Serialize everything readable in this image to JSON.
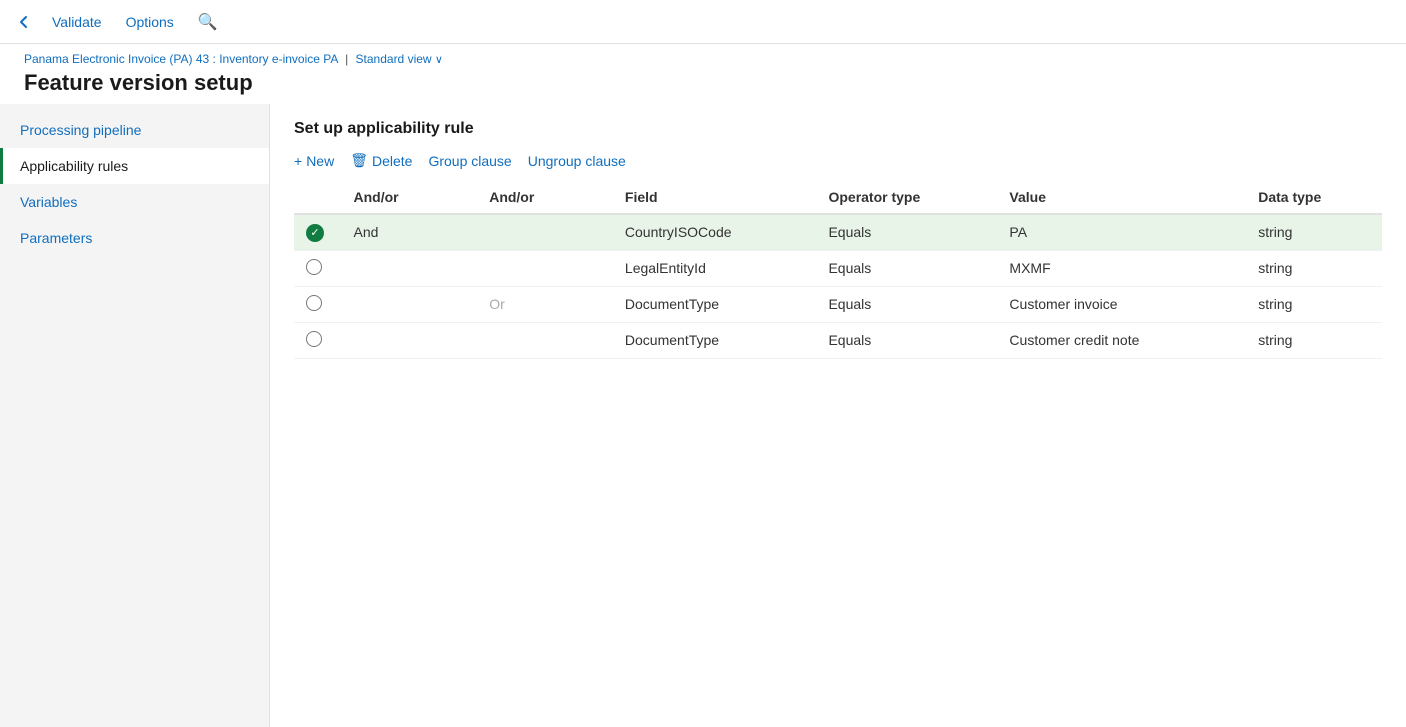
{
  "topNav": {
    "validate": "Validate",
    "options": "Options",
    "searchIcon": "🔍"
  },
  "breadcrumb": {
    "full": "Panama Electronic Invoice (PA) 43 : Inventory e-invoice PA",
    "separator": "|",
    "viewLabel": "Standard view",
    "chevron": "∨"
  },
  "pageTitle": "Feature version setup",
  "sidebar": {
    "items": [
      {
        "id": "processing-pipeline",
        "label": "Processing pipeline",
        "active": false
      },
      {
        "id": "applicability-rules",
        "label": "Applicability rules",
        "active": true
      },
      {
        "id": "variables",
        "label": "Variables",
        "active": false
      },
      {
        "id": "parameters",
        "label": "Parameters",
        "active": false
      }
    ]
  },
  "content": {
    "sectionTitle": "Set up applicability rule",
    "toolbar": {
      "newLabel": "New",
      "deleteLabel": "Delete",
      "groupClauseLabel": "Group clause",
      "ungroupClauseLabel": "Ungroup clause"
    },
    "table": {
      "columns": [
        "And/or",
        "And/or",
        "Field",
        "Operator type",
        "Value",
        "Data type"
      ],
      "rows": [
        {
          "selected": true,
          "hasGreenDot": true,
          "andor1": "And",
          "andor2": "",
          "field": "CountryISOCode",
          "operatorType": "Equals",
          "value": "PA",
          "dataType": "string"
        },
        {
          "selected": false,
          "hasGreenDot": false,
          "andor1": "",
          "andor2": "",
          "field": "LegalEntityId",
          "operatorType": "Equals",
          "value": "MXMF",
          "dataType": "string"
        },
        {
          "selected": false,
          "hasGreenDot": false,
          "andor1": "",
          "andor2": "Or",
          "field": "DocumentType",
          "operatorType": "Equals",
          "value": "Customer invoice",
          "dataType": "string"
        },
        {
          "selected": false,
          "hasGreenDot": false,
          "andor1": "",
          "andor2": "",
          "field": "DocumentType",
          "operatorType": "Equals",
          "value": "Customer credit note",
          "dataType": "string"
        }
      ]
    }
  }
}
